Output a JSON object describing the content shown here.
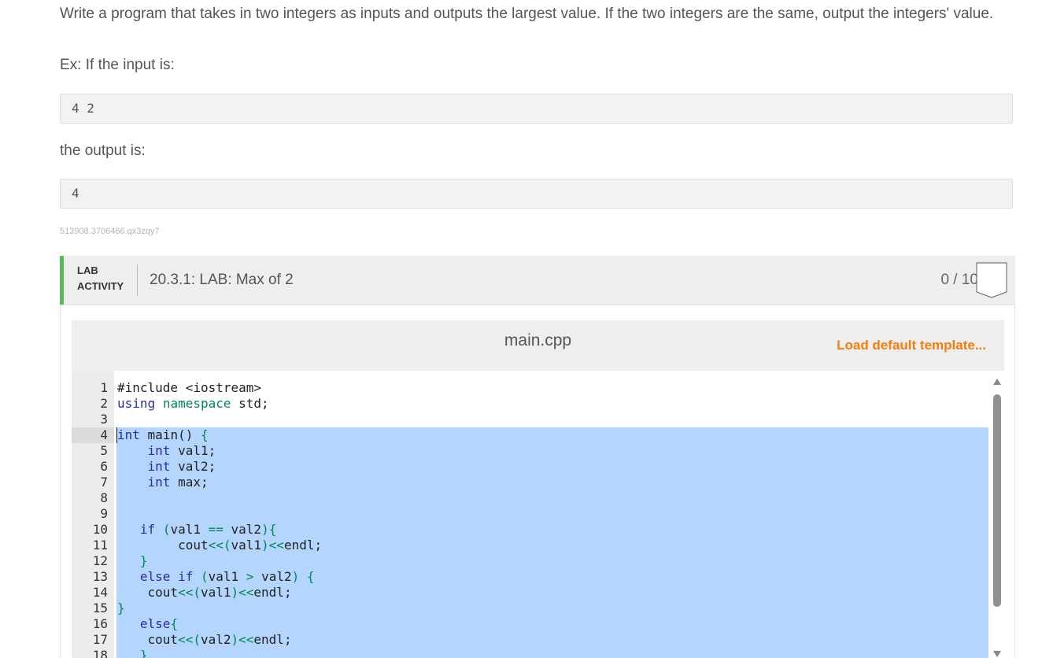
{
  "prompt": {
    "text": "Write a program that takes in two integers as inputs and outputs the largest value. If the two integers are the same, output the integers' value.",
    "example_label": "Ex: If the input is:",
    "example_input": "4 2",
    "output_label": "the output is:",
    "example_output": "4",
    "tracking_id": "513908.3706466.qx3zqy7"
  },
  "lab": {
    "tag_line1": "LAB",
    "tag_line2": "ACTIVITY",
    "title": "20.3.1: LAB: Max of 2",
    "score": "0 / 10"
  },
  "editor": {
    "filename": "main.cpp",
    "load_template_label": "Load default template...",
    "line_numbers": [
      "1",
      "2",
      "3",
      "4",
      "5",
      "6",
      "7",
      "8",
      "9",
      "10",
      "11",
      "12",
      "13",
      "14",
      "15",
      "16",
      "17",
      "18"
    ]
  },
  "colors": {
    "accent_green": "#5cb85c",
    "link_orange": "#f27f0c",
    "selection_blue": "#b4d5fe"
  }
}
